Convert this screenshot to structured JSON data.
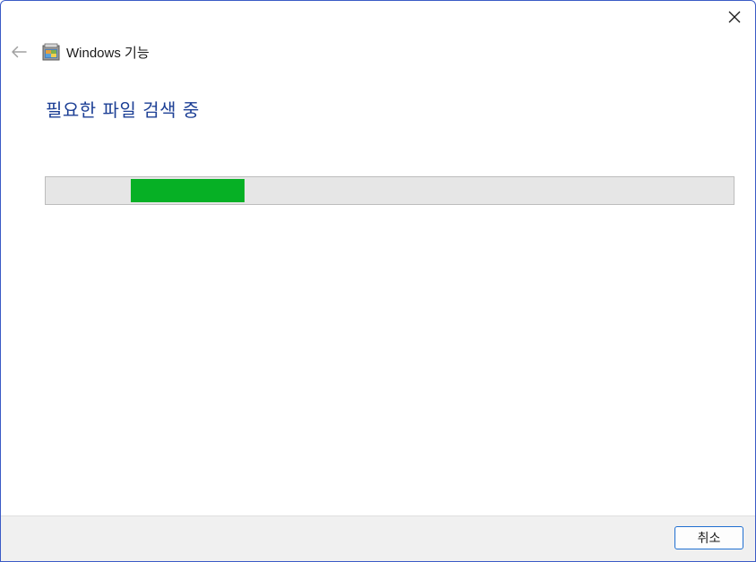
{
  "window": {
    "title": "Windows 기능",
    "close_icon": "close-icon",
    "back_icon": "back-arrow-icon",
    "app_icon": "windows-features-icon"
  },
  "main": {
    "heading": "필요한 파일 검색 중",
    "progress": {
      "style": "marquee",
      "chunk_start_fraction": 0.124,
      "chunk_length_fraction": 0.165,
      "fill_color": "#06b025",
      "track_color": "#e6e6e6"
    }
  },
  "footer": {
    "cancel_label": "취소"
  },
  "colors": {
    "heading": "#1c3f95",
    "accent_border": "#1f6fd1"
  }
}
